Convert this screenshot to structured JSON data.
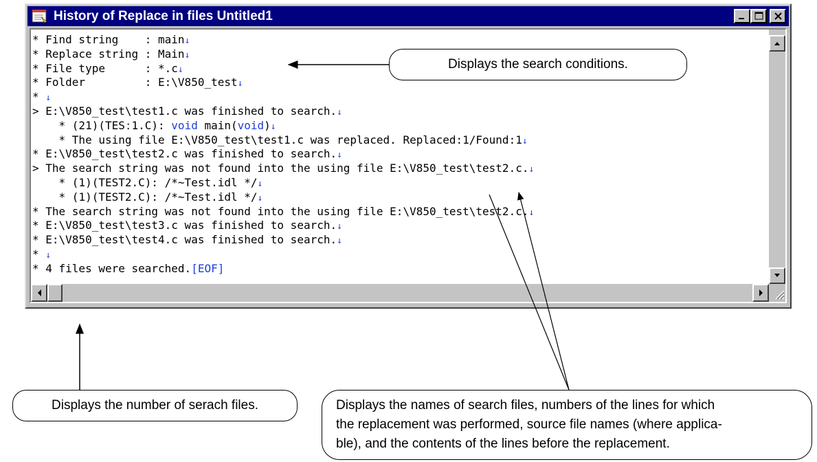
{
  "window": {
    "title": "History of Replace in files Untitled1",
    "buttons": [
      "minimize",
      "maximize",
      "close"
    ]
  },
  "editor": {
    "newline_mark": "↓",
    "lines": [
      {
        "prefix": "* ",
        "text": "Find string    : main",
        "nl": true
      },
      {
        "prefix": "* ",
        "text": "Replace string : Main",
        "nl": true
      },
      {
        "prefix": "* ",
        "text": "File type      : *.c",
        "nl": true
      },
      {
        "prefix": "* ",
        "text": "Folder         : E:\\V850_test",
        "nl": true
      },
      {
        "prefix": "* ",
        "text": "",
        "nl": true
      },
      {
        "prefix": "> ",
        "text": "E:\\V850_test\\test1.c was finished to search.",
        "nl": true
      },
      {
        "prefix": "    ",
        "text": "* (21)(TES\u001f1.C): ",
        "kw_parts": [
          "void",
          " main(",
          "void",
          ")"
        ],
        "nl": true
      },
      {
        "prefix": "    ",
        "text": "* The using file E:\\V850_test\\test1.c was replaced. Replaced:1/Found:1",
        "nl": true
      },
      {
        "prefix": "* ",
        "text": "E:\\V850_test\\test2.c was finished to search.",
        "nl": true
      },
      {
        "prefix": "> ",
        "text": "The search string was not found into the using file E:\\V850_test\\test2.c.",
        "nl": true
      },
      {
        "prefix": "    ",
        "text": "* (1)(TEST2.C): /*~Test.idl */",
        "nl": true
      },
      {
        "prefix": "    ",
        "text": "* (1)(TEST2.C): /*~Test.idl */",
        "nl": true
      },
      {
        "prefix": "* ",
        "text": "The search string was not found into the using file E:\\V850_test\\test2.c.",
        "nl": true
      },
      {
        "prefix": "* ",
        "text": "E:\\V850_test\\test3.c was finished to search.",
        "nl": true
      },
      {
        "prefix": "* ",
        "text": "E:\\V850_test\\test4.c was finished to search.",
        "nl": true
      },
      {
        "prefix": "* ",
        "text": "",
        "nl": true
      },
      {
        "prefix": "* ",
        "text": "4 files were searched.",
        "eof": "[EOF]",
        "nl": false
      }
    ]
  },
  "callouts": {
    "search_conditions": "Displays the search conditions.",
    "number_of_files": "Displays the number of serach files.",
    "search_files": [
      "Displays the names of search files, numbers of the lines for which",
      "the replacement was performed, source file names (where applica-",
      "ble), and the contents of the lines before the replacement."
    ]
  },
  "colors": {
    "titlebar": "#000080",
    "window_face": "#c0c0c0",
    "keyword": "#1d3fdb"
  }
}
